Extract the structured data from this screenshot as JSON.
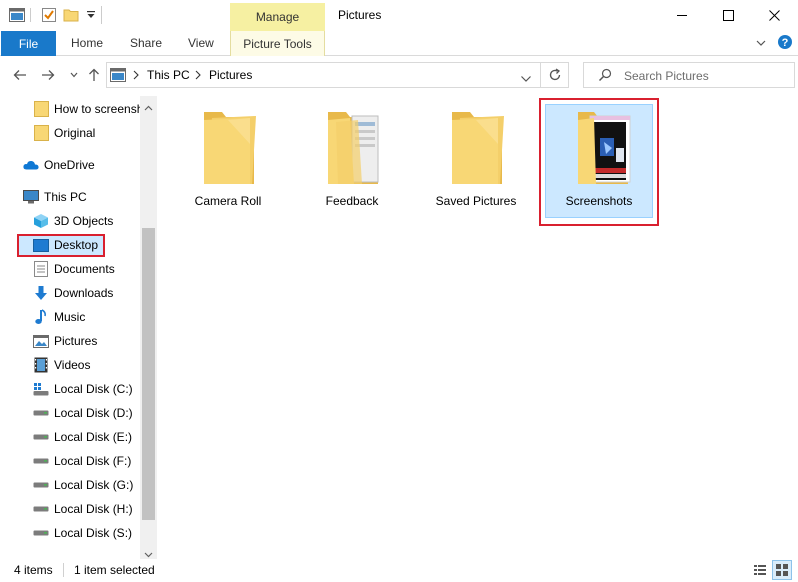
{
  "window": {
    "title": "Pictures",
    "context_tab": "Manage",
    "context_group": "Picture Tools"
  },
  "ribbon": {
    "tabs": [
      "File",
      "Home",
      "Share",
      "View",
      "Picture Tools"
    ]
  },
  "address": {
    "path": [
      "This PC",
      "Pictures"
    ]
  },
  "search": {
    "placeholder": "Search Pictures"
  },
  "nav": {
    "items": [
      {
        "label": "How to screensh",
        "icon": "folder-icon"
      },
      {
        "label": "Original",
        "icon": "folder-icon"
      },
      {
        "label": "OneDrive",
        "icon": "cloud-icon"
      },
      {
        "label": "This PC",
        "icon": "computer-icon"
      },
      {
        "label": "3D Objects",
        "icon": "cube-icon"
      },
      {
        "label": "Desktop",
        "icon": "desktop-icon"
      },
      {
        "label": "Documents",
        "icon": "documents-icon"
      },
      {
        "label": "Downloads",
        "icon": "download-icon"
      },
      {
        "label": "Music",
        "icon": "music-icon"
      },
      {
        "label": "Pictures",
        "icon": "pictures-icon"
      },
      {
        "label": "Videos",
        "icon": "videos-icon"
      },
      {
        "label": "Local Disk (C:)",
        "icon": "drive-icon"
      },
      {
        "label": "Local Disk (D:)",
        "icon": "drive-icon"
      },
      {
        "label": "Local Disk (E:)",
        "icon": "drive-icon"
      },
      {
        "label": "Local Disk (F:)",
        "icon": "drive-icon"
      },
      {
        "label": "Local Disk (G:)",
        "icon": "drive-icon"
      },
      {
        "label": "Local Disk (H:)",
        "icon": "drive-icon"
      },
      {
        "label": "Local Disk (S:)",
        "icon": "drive-icon"
      }
    ]
  },
  "folders": [
    {
      "label": "Camera Roll"
    },
    {
      "label": "Feedback"
    },
    {
      "label": "Saved Pictures"
    },
    {
      "label": "Screenshots"
    }
  ],
  "status": {
    "item_count": "4 items",
    "selection": "1 item selected"
  },
  "colors": {
    "accent": "#1979ca",
    "selection": "#cce8ff",
    "highlight_box": "#d9202f",
    "folder": "#f8d775",
    "manage_tab": "#f6f0a2"
  }
}
